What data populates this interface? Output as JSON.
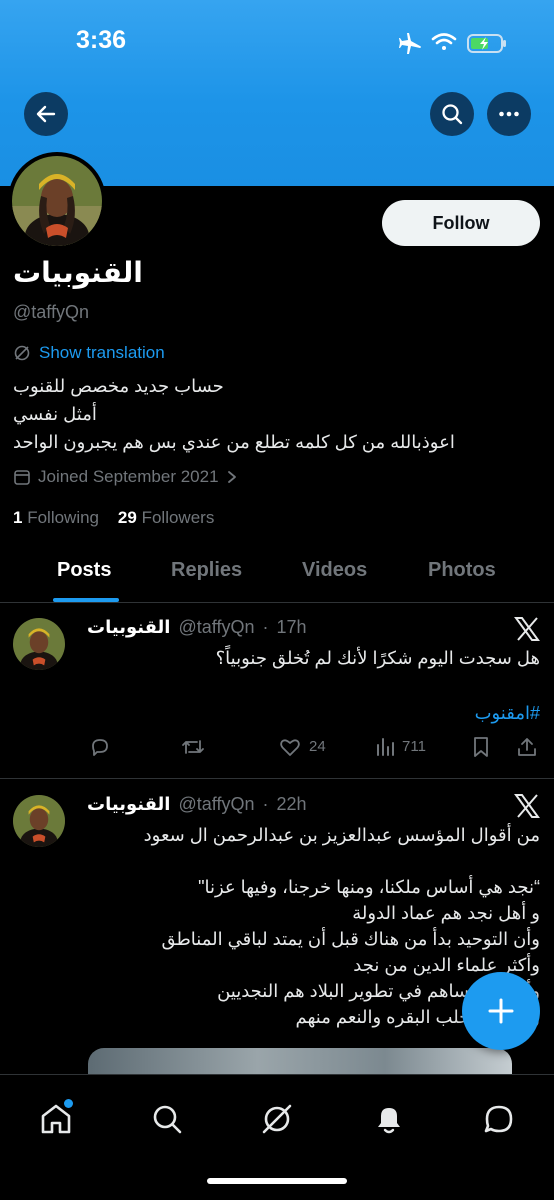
{
  "status_bar": {
    "time": "3:36"
  },
  "profile": {
    "display_name": "القنوبيات",
    "handle": "@taffyQn",
    "follow_label": "Follow",
    "show_translation": "Show translation",
    "bio_lines": [
      "حساب جديد مخصص للقنوب",
      "أمثل نفسي",
      "اعوذبالله من كل كلمه تطلع من عندي بس هم يجبرون الواحد"
    ],
    "joined": "Joined September 2021",
    "following_count": "1",
    "following_label": "Following",
    "followers_count": "29",
    "followers_label": "Followers"
  },
  "tabs": [
    {
      "label": "Posts",
      "active": true
    },
    {
      "label": "Replies",
      "active": false
    },
    {
      "label": "Videos",
      "active": false
    },
    {
      "label": "Photos",
      "active": false
    }
  ],
  "tweets": [
    {
      "name": "القنوبيات",
      "handle": "@taffyQn",
      "time": "17h",
      "text": "هل سجدت اليوم شكرًا لأنك لم تُخلق جنوبياً؟",
      "hashtag": "#امقنوب",
      "likes": "24",
      "views": "711"
    },
    {
      "name": "القنوبيات",
      "handle": "@taffyQn",
      "time": "22h",
      "lines": [
        "من أقوال المؤسس عبدالعزيز بن عبدالرحمن ال سعود",
        "",
        "“نجد هي أساس ملكنا، ومنها خرجنا، وفيها عزنا\"",
        "و أهل نجد هم عماد الدولة",
        "وأن التوحيد بدأ من هناك قبل أن يمتد لباقي المناطق",
        "وأكثر علماء الدين من نجد",
        "وأكثر من ساهم في تطوير البلاد هم النجديين",
        "وأن كان يحلب البقره والنعم منهم"
      ]
    }
  ],
  "colors": {
    "accent": "#1d9bf0",
    "banner": "#1d94e8",
    "background": "#000000",
    "muted": "#71767b"
  },
  "icons": {
    "back": "arrow-left-icon",
    "search": "search-icon",
    "more": "more-icon",
    "compose": "plus-icon",
    "nav": [
      "home-icon",
      "search-icon",
      "grok-icon",
      "bell-icon",
      "messages-icon"
    ]
  }
}
